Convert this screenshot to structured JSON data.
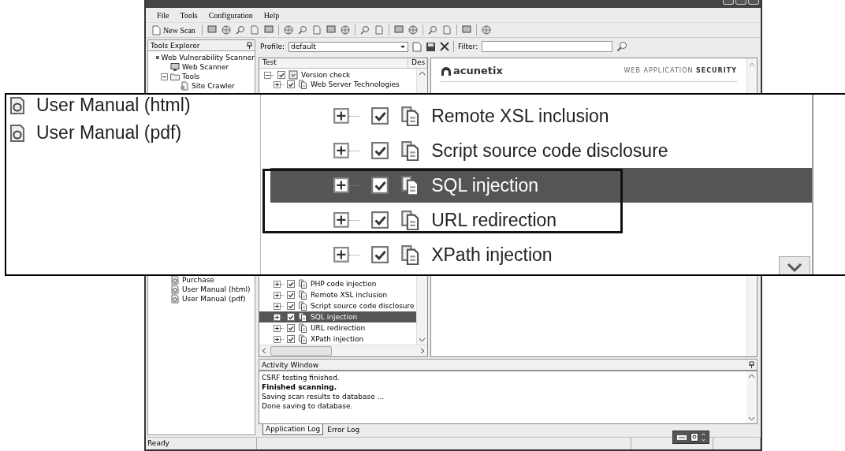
{
  "menu": [
    "File",
    "Tools",
    "Configuration",
    "Help"
  ],
  "toolbar": {
    "new_scan": "New Scan"
  },
  "tools_explorer": {
    "title": "Tools Explorer",
    "tree": [
      {
        "label": "Web Vulnerability Scanner",
        "kind": "app",
        "children": [
          {
            "label": "Web Scanner",
            "kind": "scanner"
          },
          {
            "label": "Tools",
            "kind": "folder",
            "expanded": true,
            "children": [
              {
                "label": "Site Crawler",
                "kind": "tool"
              }
            ]
          }
        ]
      }
    ],
    "tree_lower": [
      {
        "label": "Purchase",
        "kind": "page"
      },
      {
        "label": "User Manual (html)",
        "kind": "page"
      },
      {
        "label": "User Manual (pdf)",
        "kind": "page"
      }
    ]
  },
  "profile_bar": {
    "label": "Profile:",
    "value": "default",
    "filter_label": "Filter:"
  },
  "tests": {
    "columns": [
      "Test",
      "Des"
    ],
    "rows_top": [
      {
        "label": "Version check",
        "kind": "group",
        "expanded": true,
        "checked": true,
        "children": [
          {
            "label": "Web Server Technologies",
            "expanded": false,
            "checked": true
          }
        ]
      }
    ],
    "rows_bottom": [
      {
        "label": "PHP code injection",
        "expanded": false,
        "checked": true,
        "selected": false
      },
      {
        "label": "Remote XSL inclusion",
        "expanded": false,
        "checked": true,
        "selected": false
      },
      {
        "label": "Script source code disclosure",
        "expanded": false,
        "checked": true,
        "selected": false
      },
      {
        "label": "SQL injection",
        "expanded": false,
        "checked": true,
        "selected": true
      },
      {
        "label": "URL redirection",
        "expanded": false,
        "checked": true,
        "selected": false
      },
      {
        "label": "XPath injection",
        "expanded": false,
        "checked": true,
        "selected": false
      }
    ]
  },
  "info_panel": {
    "brand": "acunetix",
    "tagline": "WEB APPLICATION **SECURITY**"
  },
  "activity": {
    "title": "Activity Window",
    "lines": [
      {
        "text": "CSRF testing finished.",
        "bold": false
      },
      {
        "text": "Finished scanning.",
        "bold": true
      },
      {
        "text": "Saving scan results to database ...",
        "bold": false
      },
      {
        "text": "Done saving to database.",
        "bold": false
      }
    ],
    "tabs": [
      {
        "label": "Application Log",
        "selected": true
      },
      {
        "label": "Error Log",
        "selected": false
      }
    ]
  },
  "status_bar": {
    "text": "Ready"
  },
  "callout": {
    "explorer_items": [
      {
        "label": "User Manual (html)"
      },
      {
        "label": "User Manual (pdf)"
      }
    ],
    "rows": [
      {
        "label": "Remote XSL inclusion",
        "expanded": false,
        "checked": true,
        "selected": false
      },
      {
        "label": "Script source code disclosure",
        "expanded": false,
        "checked": true,
        "selected": false
      },
      {
        "label": "SQL injection",
        "expanded": false,
        "checked": true,
        "selected": true
      },
      {
        "label": "URL redirection",
        "expanded": false,
        "checked": true,
        "selected": false
      },
      {
        "label": "XPath injection",
        "expanded": false,
        "checked": true,
        "selected": false
      }
    ]
  }
}
